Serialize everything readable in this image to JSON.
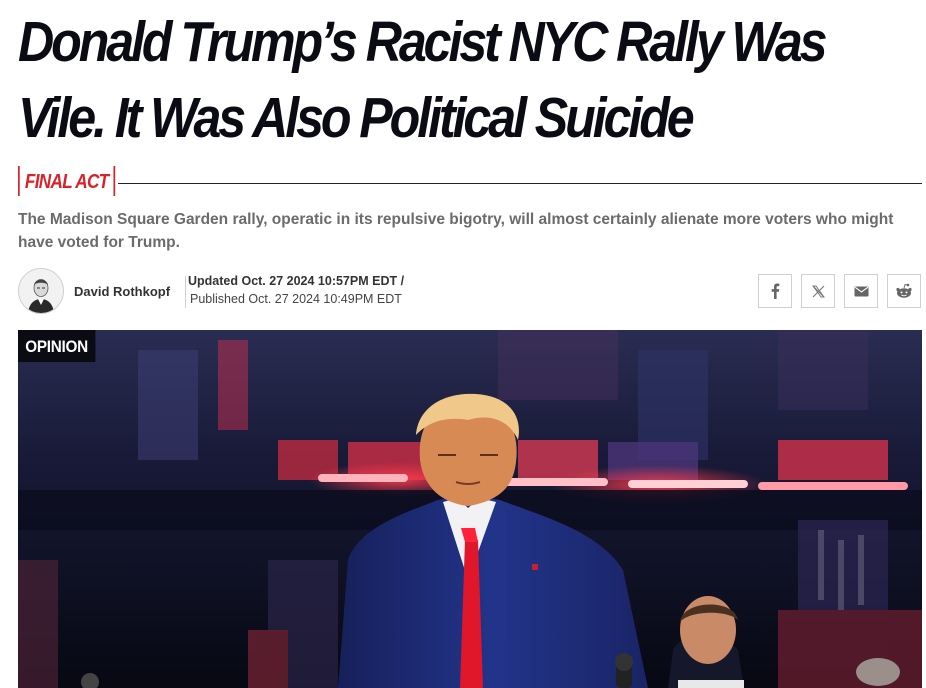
{
  "article": {
    "headline": "Donald Trump’s Racist NYC Rally Was Vile. It Was Also Political Suicide",
    "rubric": "FINAL ACT",
    "dek": "The Madison Square Garden rally, operatic in its repulsive bigotry, will almost certainly alienate more voters who might have voted for Trump.",
    "author": "David Rothkopf",
    "updated": "Updated Oct. 27 2024 10:57PM EDT /",
    "published": "Published Oct. 27 2024 10:49PM EDT",
    "section_tag": "OPINION"
  },
  "share": {
    "icons": [
      "facebook-icon",
      "x-icon",
      "email-icon",
      "reddit-icon"
    ]
  },
  "colors": {
    "accent": "#d8232a",
    "headline": "#0b0b14",
    "dek": "#6b6b6b"
  }
}
